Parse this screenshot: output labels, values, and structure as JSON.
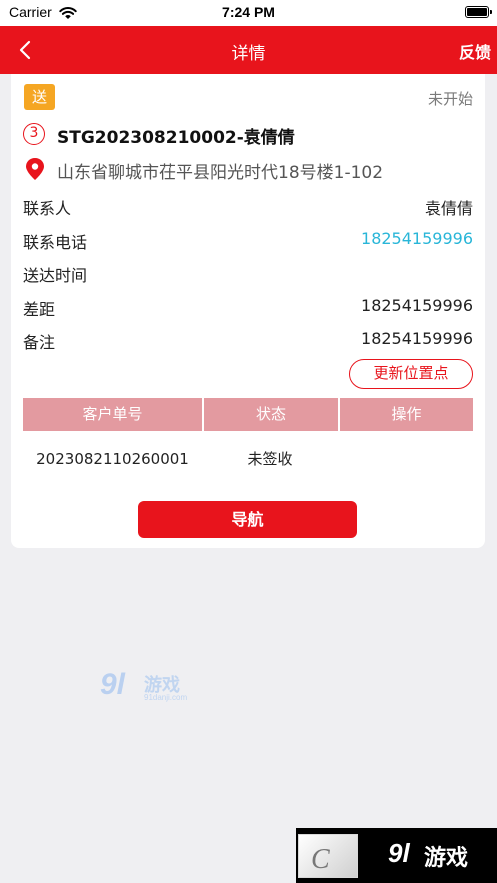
{
  "status_bar": {
    "carrier": "Carrier",
    "time": "7:24 PM"
  },
  "nav": {
    "title": "详情",
    "feedback": "反馈"
  },
  "order": {
    "type_tag": "送",
    "status": "未开始",
    "sequence": "3",
    "title": "STG202308210002-袁倩倩",
    "address": "山东省聊城市茌平县阳光时代18号楼1-102"
  },
  "details": [
    {
      "label": "联系人",
      "value": "袁倩倩"
    },
    {
      "label": "联系电话",
      "value": "18254159996"
    },
    {
      "label": "送达时间",
      "value": ""
    },
    {
      "label": "差距",
      "value": "18254159996"
    },
    {
      "label": "备注",
      "value": "18254159996"
    }
  ],
  "update_location_label": "更新位置点",
  "table": {
    "headers": [
      "客户单号",
      "状态",
      "操作"
    ],
    "rows": [
      [
        "2023082110260001",
        "未签收",
        ""
      ]
    ]
  },
  "navigate_label": "导航",
  "watermark": {
    "num": "9l",
    "text": "游戏",
    "sub": "91danji.com"
  },
  "colors": {
    "brand_red": "#e8141c",
    "tag_orange": "#f5a623",
    "link_blue": "#29b6d8",
    "table_header": "#e39aa0"
  }
}
